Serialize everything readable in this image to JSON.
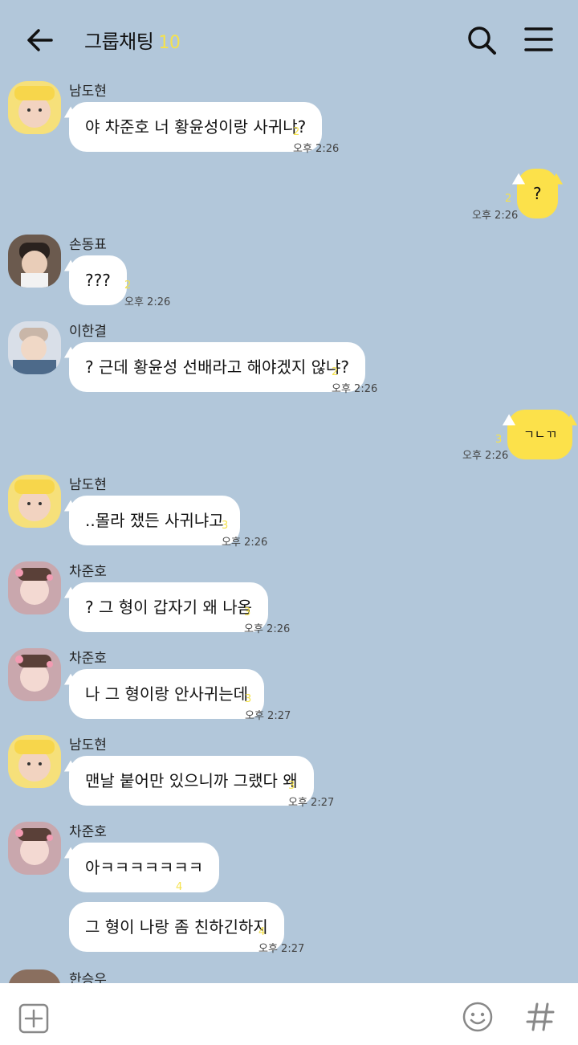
{
  "header": {
    "title": "그룹채팅",
    "member_count": "10"
  },
  "messages": [
    {
      "sender": "남도현",
      "text": "야 차준호 너 황윤성이랑 사귀냐?",
      "unread": "2",
      "time": "오후 2:26"
    },
    {
      "sender": "me",
      "text": "?",
      "unread": "2",
      "time": "오후 2:26"
    },
    {
      "sender": "손동표",
      "text": "???",
      "unread": "2",
      "time": "오후 2:26"
    },
    {
      "sender": "이한결",
      "text": "? 근데 황윤성 선배라고 해야겠지 않냐?",
      "unread": "2",
      "time": "오후 2:26"
    },
    {
      "sender": "me",
      "text": "ㄱㄴㄲ",
      "unread": "3",
      "time": "오후 2:26"
    },
    {
      "sender": "남도현",
      "text": "..몰라 쟀든 사귀냐고",
      "unread": "3",
      "time": "오후 2:26"
    },
    {
      "sender": "차준호",
      "text": "? 그 형이 갑자기 왜 나옴",
      "unread": "3",
      "time": "오후 2:26"
    },
    {
      "sender": "차준호",
      "text": "나 그 형이랑 안사귀는데",
      "unread": "3",
      "time": "오후 2:27"
    },
    {
      "sender": "남도현",
      "text": "맨날 붙어만 있으니까 그랬다 왜",
      "unread": "3",
      "time": "오후 2:27"
    },
    {
      "sender": "차준호",
      "text": "아ㅋㅋㅋㅋㅋㅋㅋ",
      "unread": "4",
      "time": ""
    },
    {
      "sender": "차준호",
      "text": "그 형이 나랑 좀 친하긴하지",
      "unread": "4",
      "time": "오후 2:27"
    },
    {
      "sender": "한승우",
      "text": "",
      "unread": "",
      "time": ""
    }
  ],
  "colors": {
    "background": "#b2c7da",
    "my_bubble": "#fce14a",
    "unread": "#f5e24c"
  }
}
